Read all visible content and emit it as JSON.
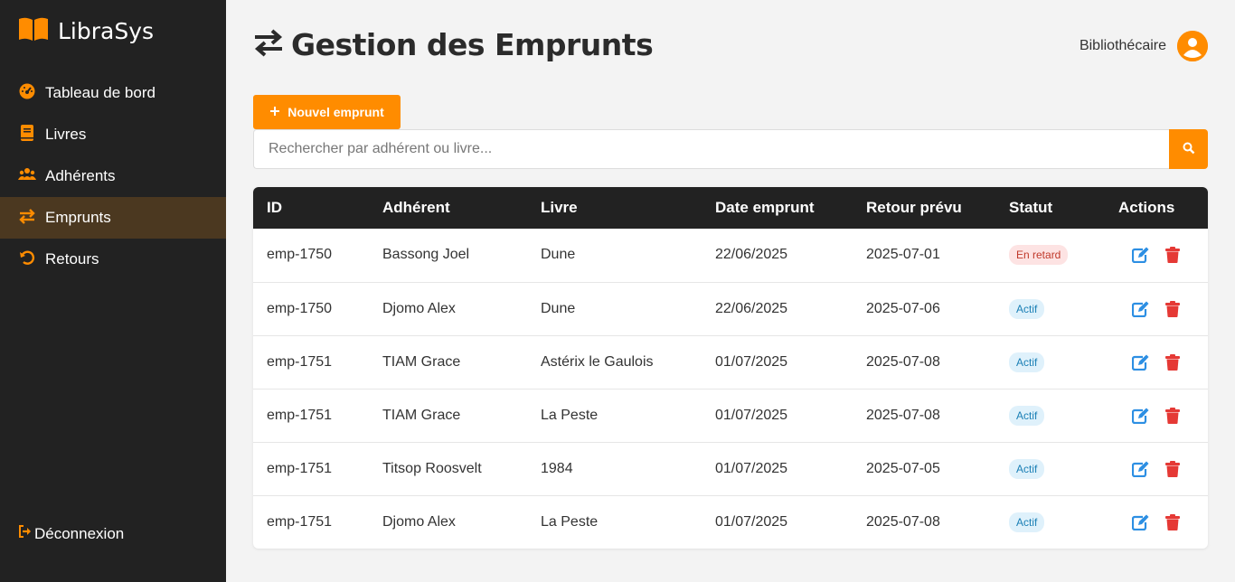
{
  "app": {
    "name": "LibraSys",
    "accent": "#ff8c00"
  },
  "sidebar": {
    "items": [
      {
        "label": "Tableau de bord",
        "icon": "dashboard-icon"
      },
      {
        "label": "Livres",
        "icon": "book-icon"
      },
      {
        "label": "Adhérents",
        "icon": "users-icon"
      },
      {
        "label": "Emprunts",
        "icon": "exchange-icon",
        "active": true
      },
      {
        "label": "Retours",
        "icon": "undo-icon"
      }
    ],
    "logout_label": "Déconnexion"
  },
  "header": {
    "title": "Gestion des Emprunts",
    "user_role": "Bibliothécaire"
  },
  "toolbar": {
    "new_label": "Nouvel emprunt",
    "search_placeholder": "Rechercher par adhérent ou livre..."
  },
  "table": {
    "columns": [
      "ID",
      "Adhérent",
      "Livre",
      "Date emprunt",
      "Retour prévu",
      "Statut",
      "Actions"
    ],
    "rows": [
      {
        "id": "emp-1750",
        "member": "Bassong Joel",
        "book": "Dune",
        "borrowed": "22/06/2025",
        "due": "2025-07-01",
        "status": "En retard",
        "status_type": "late"
      },
      {
        "id": "emp-1750",
        "member": "Djomo Alex",
        "book": "Dune",
        "borrowed": "22/06/2025",
        "due": "2025-07-06",
        "status": "Actif",
        "status_type": "active"
      },
      {
        "id": "emp-1751",
        "member": "TIAM Grace",
        "book": "Astérix le Gaulois",
        "borrowed": "01/07/2025",
        "due": "2025-07-08",
        "status": "Actif",
        "status_type": "active"
      },
      {
        "id": "emp-1751",
        "member": "TIAM Grace",
        "book": "La Peste",
        "borrowed": "01/07/2025",
        "due": "2025-07-08",
        "status": "Actif",
        "status_type": "active"
      },
      {
        "id": "emp-1751",
        "member": "Titsop Roosvelt",
        "book": "1984",
        "borrowed": "01/07/2025",
        "due": "2025-07-05",
        "status": "Actif",
        "status_type": "active"
      },
      {
        "id": "emp-1751",
        "member": "Djomo Alex",
        "book": "La Peste",
        "borrowed": "01/07/2025",
        "due": "2025-07-08",
        "status": "Actif",
        "status_type": "active"
      }
    ]
  }
}
